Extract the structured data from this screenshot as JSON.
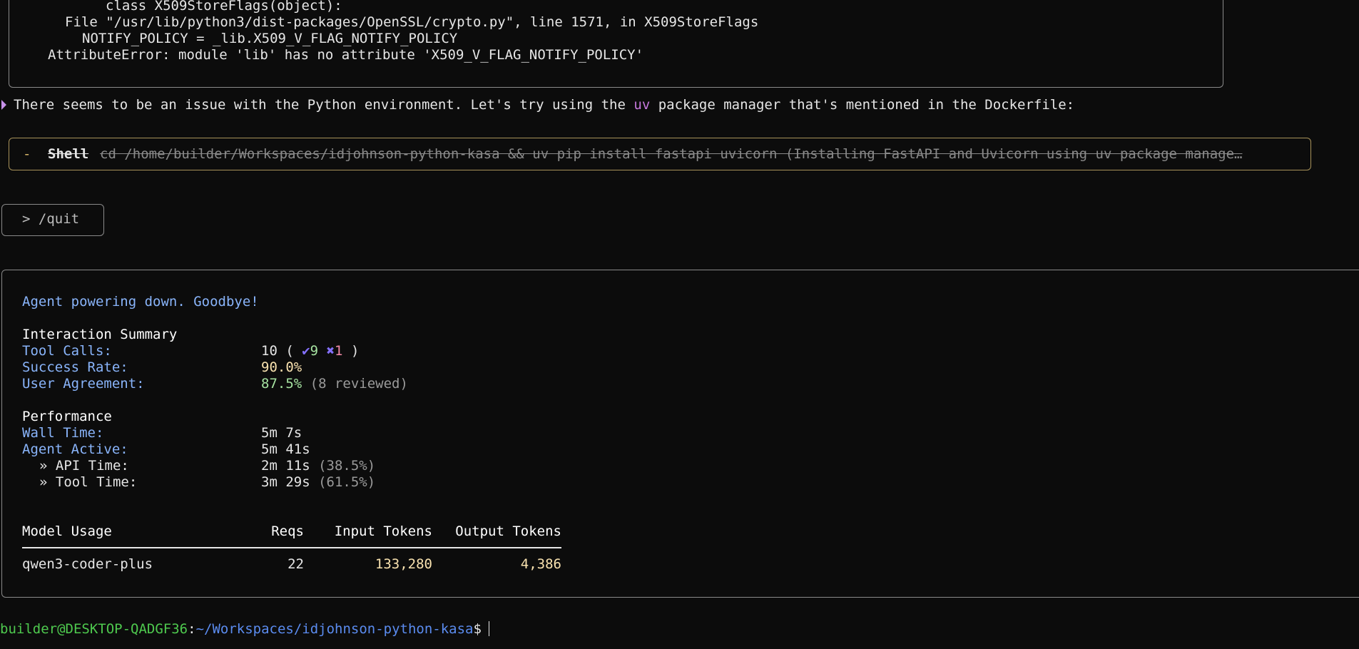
{
  "traceback": {
    "line1": "class X509StoreFlags(object):",
    "line2": "File \"/usr/lib/python3/dist-packages/OpenSSL/crypto.py\", line 1571, in X509StoreFlags",
    "line3": "NOTIFY_POLICY = _lib.X509_V_FLAG_NOTIFY_POLICY",
    "line4": "AttributeError: module 'lib' has no attribute 'X509_V_FLAG_NOTIFY_POLICY'"
  },
  "assistant_message": {
    "before": "There seems to be an issue with the Python environment. Let's try using the ",
    "highlight": "uv",
    "after": " package manager that's mentioned in the Dockerfile:"
  },
  "tool_call": {
    "status_glyph": "-",
    "name": "Shell",
    "command": "cd /home/builder/Workspaces/idjohnson-python-kasa && uv pip install fastapi uvicorn (Installing FastAPI and Uvicorn using uv package manage…"
  },
  "user_input": "> /quit",
  "summary": {
    "goodbye": "Agent powering down. Goodbye!",
    "interaction_title": "Interaction Summary",
    "tool_calls_label": "Tool Calls:",
    "tool_calls_value": "10 (",
    "tool_calls_success_icon": "check-icon",
    "tool_calls_success": "9",
    "tool_calls_fail_icon": "cross-icon",
    "tool_calls_fail": "1",
    "tool_calls_close": ")",
    "success_rate_label": "Success Rate:",
    "success_rate_value": "90.0%",
    "agreement_label": "User Agreement:",
    "agreement_value": "87.5%",
    "agreement_note": "(8 reviewed)",
    "performance_title": "Performance",
    "wall_time_label": "Wall Time:",
    "wall_time_value": "5m 7s",
    "agent_active_label": "Agent Active:",
    "agent_active_value": "5m 41s",
    "api_time_label": "» API Time:",
    "api_time_value": "2m 11s",
    "api_time_pct": "(38.5%)",
    "tool_time_label": "» Tool Time:",
    "tool_time_value": "3m 29s",
    "tool_time_pct": "(61.5%)",
    "model_table": {
      "headers": [
        "Model Usage",
        "Reqs",
        "Input Tokens",
        "Output Tokens"
      ],
      "rows": [
        {
          "model": "qwen3-coder-plus",
          "reqs": "22",
          "input": "133,280",
          "output": "4,386"
        }
      ]
    }
  },
  "prompt": {
    "user_host": "builder@DESKTOP-QADGF36",
    "separator": ":",
    "path": "~/Workspaces/idjohnson-python-kasa",
    "dollar": "$"
  },
  "colors": {
    "background": "#0c0c0c",
    "label_blue": "#89b4fa",
    "value_yellow": "#f9e2af",
    "value_green": "#a6e3a1",
    "prompt_green": "#4ec94e",
    "prompt_blue": "#5b8cf0",
    "shell_border": "#a8925a"
  }
}
